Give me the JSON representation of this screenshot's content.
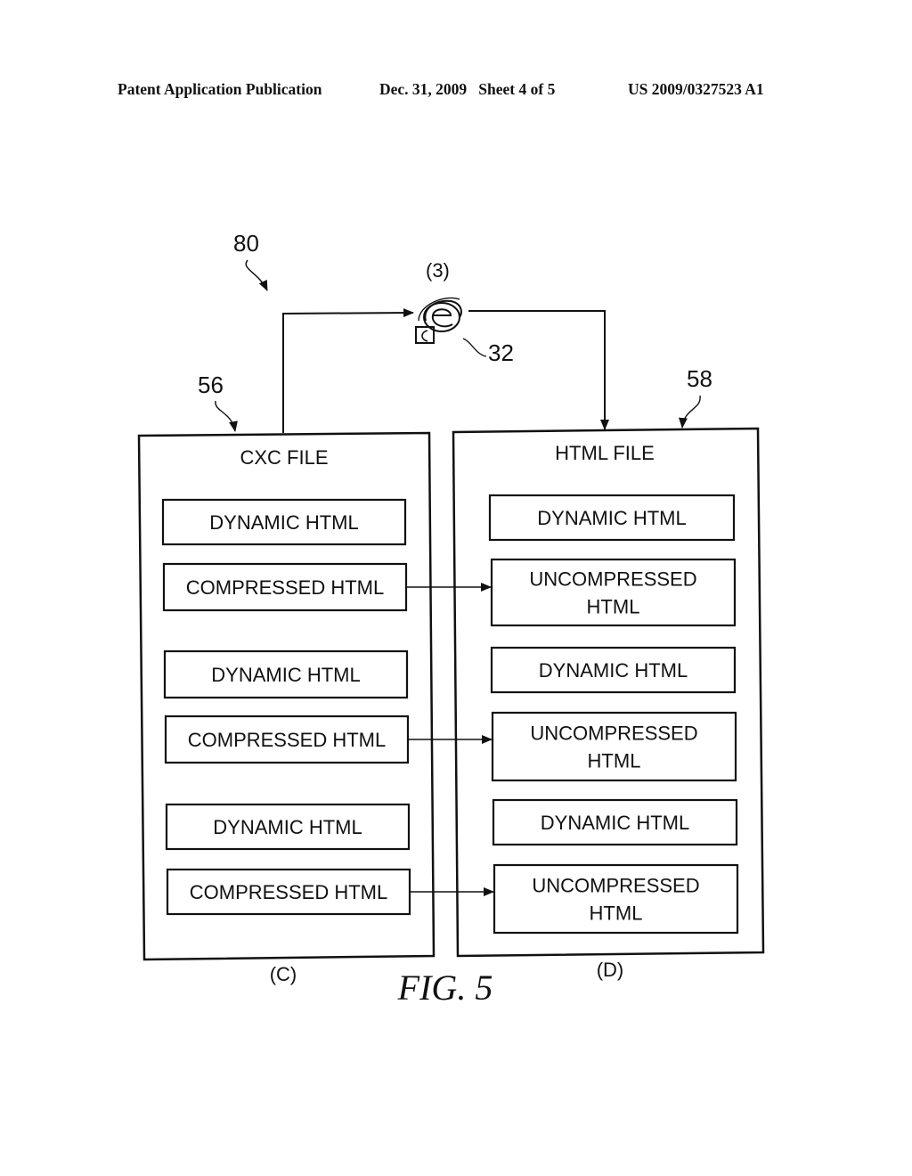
{
  "header": {
    "publication": "Patent Application Publication",
    "date_sheet": "Dec. 31, 2009   Sheet 4 of 5",
    "number": "US 2009/0327523 A1"
  },
  "figure": {
    "caption": "FIG. 5",
    "ref_system": "80",
    "browser": {
      "step_label": "(3)",
      "ref": "32",
      "icon": "internet-explorer-icon"
    },
    "left_file": {
      "ref": "56",
      "title": "CXC FILE",
      "caption": "(C)",
      "blocks": [
        "DYNAMIC HTML",
        "COMPRESSED HTML",
        "DYNAMIC HTML",
        "COMPRESSED HTML",
        "DYNAMIC HTML",
        "COMPRESSED HTML"
      ]
    },
    "right_file": {
      "ref": "58",
      "title": "HTML FILE",
      "caption": "(D)",
      "blocks": [
        [
          "DYNAMIC HTML"
        ],
        [
          "UNCOMPRESSED",
          "HTML"
        ],
        [
          "DYNAMIC HTML"
        ],
        [
          "UNCOMPRESSED",
          "HTML"
        ],
        [
          "DYNAMIC HTML"
        ],
        [
          "UNCOMPRESSED",
          "HTML"
        ]
      ]
    }
  }
}
